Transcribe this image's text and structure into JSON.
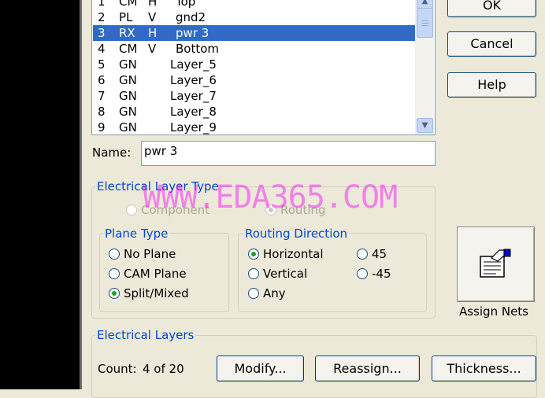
{
  "layers": [
    {
      "num": "1",
      "type": "CM",
      "dir": "H",
      "name": "Top"
    },
    {
      "num": "2",
      "type": "PL",
      "dir": "V",
      "name": "gnd2"
    },
    {
      "num": "3",
      "type": "RX",
      "dir": "H",
      "name": "pwr 3"
    },
    {
      "num": "4",
      "type": "CM",
      "dir": "V",
      "name": "Bottom"
    },
    {
      "num": "5",
      "type": "GN",
      "dir": "",
      "name": "Layer_5"
    },
    {
      "num": "6",
      "type": "GN",
      "dir": "",
      "name": "Layer_6"
    },
    {
      "num": "7",
      "type": "GN",
      "dir": "",
      "name": "Layer_7"
    },
    {
      "num": "8",
      "type": "GN",
      "dir": "",
      "name": "Layer_8"
    },
    {
      "num": "9",
      "type": "GN",
      "dir": "",
      "name": "Layer_9"
    }
  ],
  "buttons": {
    "ok": "OK",
    "cancel": "Cancel",
    "help": "Help",
    "assign_nets": "Assign Nets",
    "modify": "Modify...",
    "reassign": "Reassign...",
    "thickness": "Thickness..."
  },
  "name_field": {
    "label": "Name:",
    "value": "pwr 3"
  },
  "electrical_layer_type": {
    "title": "Electrical Layer Type",
    "component": "Component",
    "routing": "Routing"
  },
  "plane_type": {
    "title": "Plane Type",
    "options": [
      "No Plane",
      "CAM Plane",
      "Split/Mixed"
    ]
  },
  "routing_direction": {
    "title": "Routing Direction",
    "options": [
      "Horizontal",
      "Vertical",
      "Any",
      "45",
      "-45"
    ]
  },
  "electrical_layers": {
    "title": "Electrical Layers",
    "count_label": "Count:",
    "count_value": "4 of 20"
  },
  "watermark": "WWW.EDA365.COM"
}
